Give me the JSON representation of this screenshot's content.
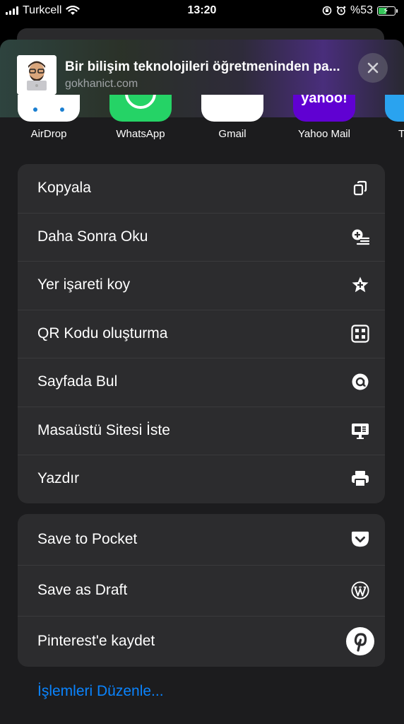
{
  "status_bar": {
    "carrier": "Turkcell",
    "time": "13:20",
    "battery_percent": "%53",
    "battery_level": 0.53,
    "icons": [
      "signal-icon",
      "wifi-icon",
      "orientation-lock-icon",
      "alarm-icon",
      "battery-charging-icon"
    ]
  },
  "header": {
    "title": "Bir bilişim teknolojileri öğretmeninden pa...",
    "url": "gokhanict.com",
    "close_icon": "close-icon"
  },
  "apps": [
    {
      "label": "AirDrop",
      "color": "#ffffff"
    },
    {
      "label": "WhatsApp",
      "color": "#25d366"
    },
    {
      "label": "Gmail",
      "color": "#ffffff"
    },
    {
      "label": "Yahoo Mail",
      "color": "#6001d2",
      "icon_text": "yahoo!"
    },
    {
      "label": "T",
      "color": "#2aa3ef"
    }
  ],
  "actions": [
    {
      "label": "Kopyala",
      "icon": "copy-icon"
    },
    {
      "label": "Daha Sonra Oku",
      "icon": "reading-list-add-icon"
    },
    {
      "label": "Yer işareti koy",
      "icon": "bookmark-star-icon"
    },
    {
      "label": "QR Kodu oluşturma",
      "icon": "qr-code-icon"
    },
    {
      "label": "Sayfada Bul",
      "icon": "find-on-page-icon"
    },
    {
      "label": "Masaüstü Sitesi İste",
      "icon": "desktop-site-icon"
    },
    {
      "label": "Yazdır",
      "icon": "print-icon"
    }
  ],
  "extensions": [
    {
      "label": "Save to Pocket",
      "icon": "pocket-icon"
    },
    {
      "label": "Save as Draft",
      "icon": "wordpress-icon"
    },
    {
      "label": "Pinterest'e kaydet",
      "icon": "pinterest-icon"
    }
  ],
  "edit_actions_label": "İşlemleri Düzenle...",
  "colors": {
    "accent": "#0a84ff",
    "sheet": "#1c1c1e",
    "group": "#2c2c2e"
  }
}
